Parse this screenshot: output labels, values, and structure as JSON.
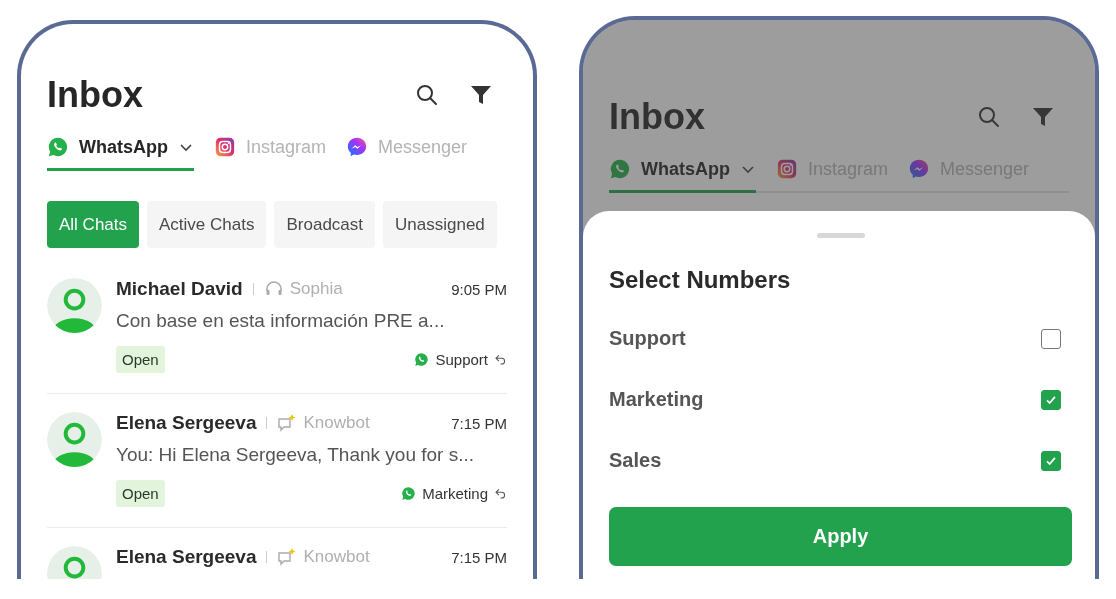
{
  "phones": [
    {
      "title": "Inbox",
      "dimmed": false,
      "channels": [
        {
          "kind": "whatsapp",
          "label": "WhatsApp",
          "selected": true,
          "dropdown": true
        },
        {
          "kind": "instagram",
          "label": "Instagram",
          "selected": false,
          "dropdown": false
        },
        {
          "kind": "messenger",
          "label": "Messenger",
          "selected": false,
          "dropdown": false
        }
      ],
      "filters": [
        {
          "label": "All Chats",
          "selected": true
        },
        {
          "label": "Active Chats",
          "selected": false
        },
        {
          "label": "Broadcast",
          "selected": false
        },
        {
          "label": "Unassigned",
          "selected": false
        }
      ],
      "chats": [
        {
          "name": "Michael David",
          "kind": "agent",
          "agent": "Sophia",
          "time": "9:05 PM",
          "preview": "Con base en esta información PRE a...",
          "status": "Open",
          "number": "Support"
        },
        {
          "name": "Elena Sergeeva",
          "kind": "bot",
          "agent": "Knowbot",
          "time": "7:15 PM",
          "preview": "You: Hi Elena Sergeeva, Thank you for s...",
          "status": "Open",
          "number": "Marketing"
        },
        {
          "name": "Elena Sergeeva",
          "kind": "bot",
          "agent": "Knowbot",
          "time": "7:15 PM"
        }
      ]
    },
    {
      "title": "Inbox",
      "dimmed": true,
      "channels": [
        {
          "kind": "whatsapp",
          "label": "WhatsApp",
          "selected": true,
          "dropdown": true
        },
        {
          "kind": "instagram",
          "label": "Instagram",
          "selected": false,
          "dropdown": false
        },
        {
          "kind": "messenger",
          "label": "Messenger",
          "selected": false,
          "dropdown": false
        }
      ],
      "sheet": {
        "title": "Select Numbers",
        "options": [
          {
            "label": "Support",
            "checked": false
          },
          {
            "label": "Marketing",
            "checked": true
          },
          {
            "label": "Sales",
            "checked": true
          }
        ],
        "button": "Apply"
      }
    }
  ]
}
